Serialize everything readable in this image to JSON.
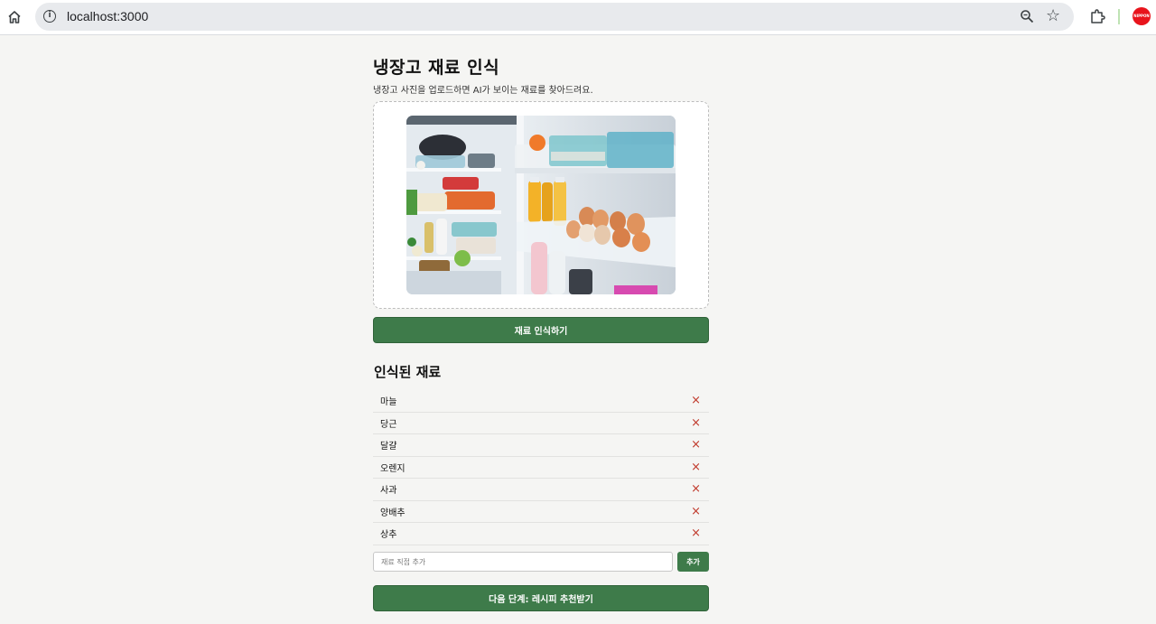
{
  "browser": {
    "url": "localhost:3000",
    "avatar_label": "NIPPON"
  },
  "app": {
    "title": "냉장고 재료 인식",
    "subtitle": "냉장고 사진을 업로드하면 AI가 보이는 재료를 찾아드려요.",
    "photo_icon": "fridge-photo",
    "recognize_button": "재료 인식하기",
    "section_title": "인식된 재료",
    "ingredients": [
      {
        "name": "마늘"
      },
      {
        "name": "당근"
      },
      {
        "name": "달걀"
      },
      {
        "name": "오렌지"
      },
      {
        "name": "사과"
      },
      {
        "name": "양배추"
      },
      {
        "name": "상추"
      }
    ],
    "remove_symbol": "×",
    "add_placeholder": "재료 직접 추가",
    "add_button": "추가",
    "next_button": "다음 단계: 레시피 추천받기"
  },
  "colors": {
    "primary": "#3e7b4a",
    "remove": "#c0392b",
    "background": "#f5f5f3"
  }
}
